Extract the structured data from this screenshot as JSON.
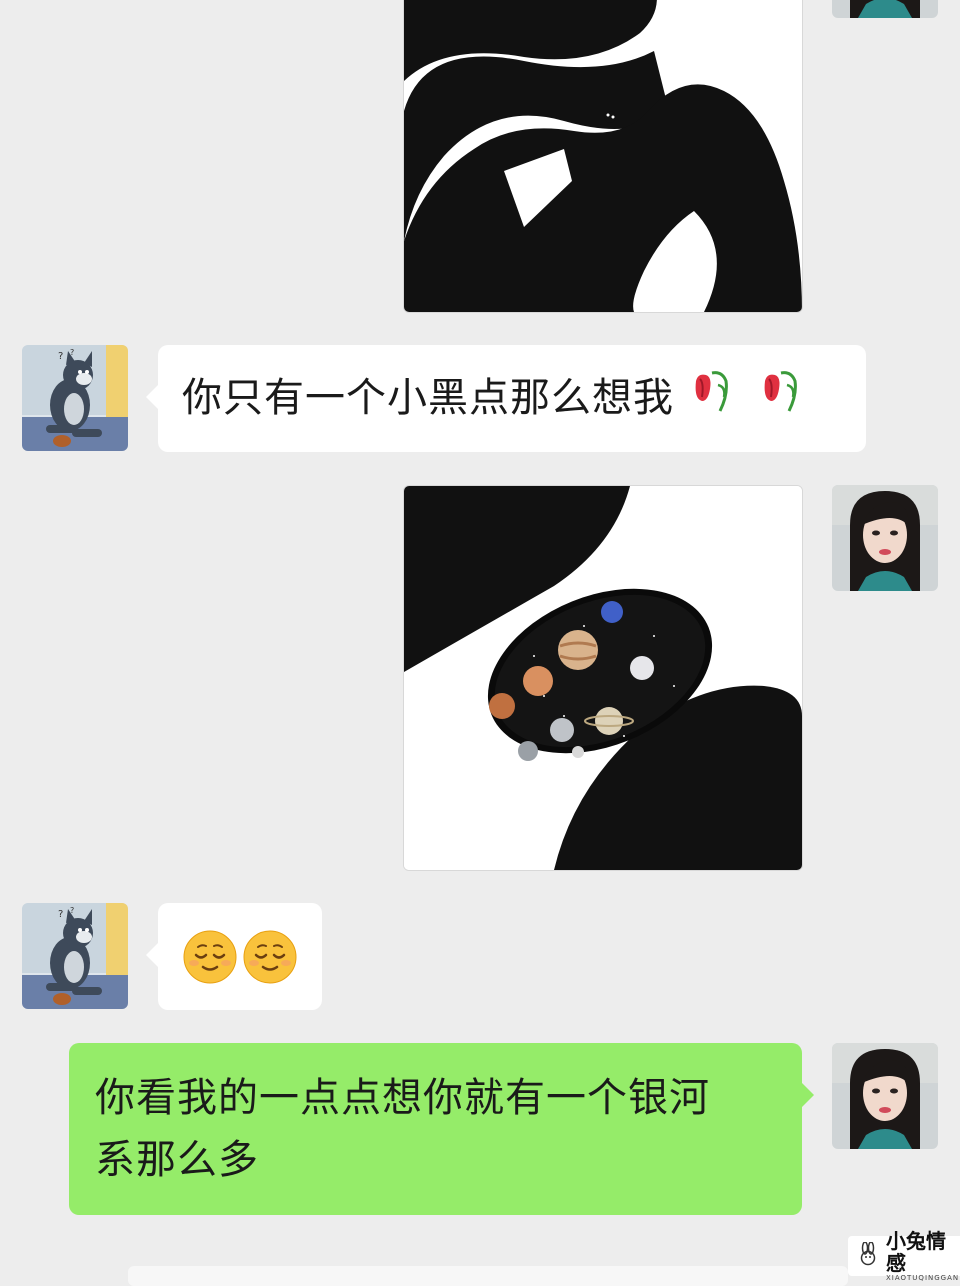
{
  "messages": [
    {
      "side": "right",
      "type": "image",
      "image": "black-blob-with-small-dot"
    },
    {
      "side": "left",
      "type": "text",
      "text": "你只有一个小黑点那么想我",
      "emojis": [
        "wilted-rose-icon",
        "wilted-rose-icon"
      ]
    },
    {
      "side": "right",
      "type": "image",
      "image": "black-blob-with-galaxy"
    },
    {
      "side": "left",
      "type": "emoji",
      "emojis": [
        "relieved-face-icon",
        "relieved-face-icon"
      ]
    },
    {
      "side": "right",
      "type": "text",
      "text_line1": "你看我的一点点想你就有一个银河",
      "text_line2": "系那么多"
    }
  ],
  "avatars": {
    "left": "cartoon-cat-avatar",
    "right": "girl-photo-avatar"
  },
  "colors": {
    "background": "#ededed",
    "bubble_left": "#ffffff",
    "bubble_right": "#95ec69"
  },
  "watermark": {
    "title": "小兔情感",
    "subtitle": "XIAOTUQINGGAN",
    "icon": "rabbit-logo-icon"
  }
}
